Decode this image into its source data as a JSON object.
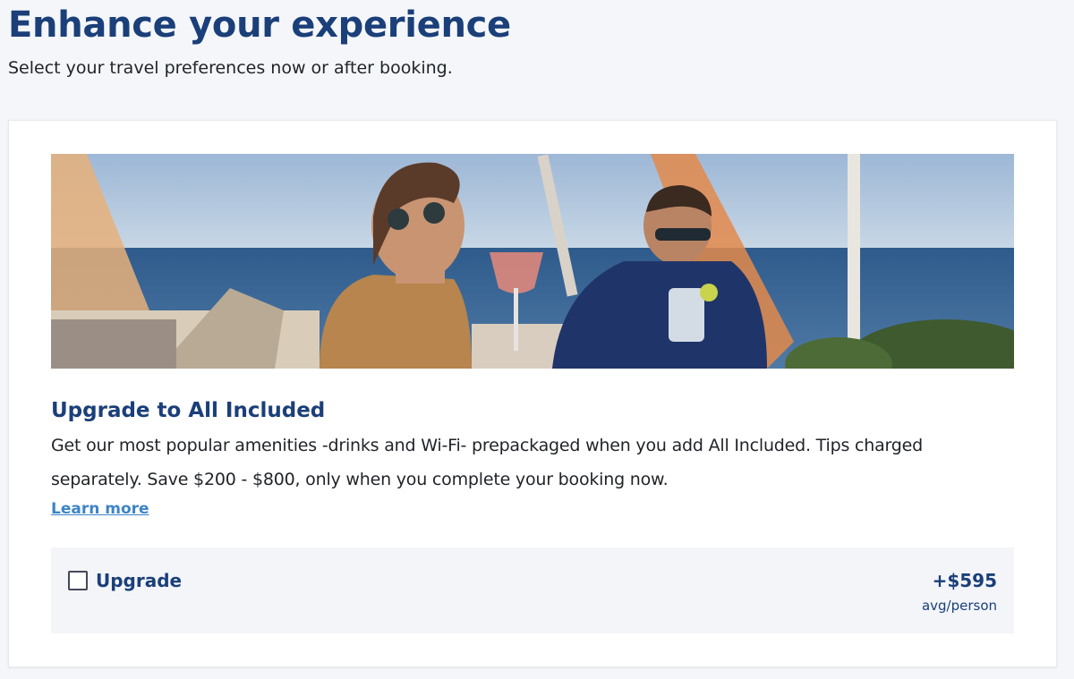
{
  "header": {
    "title": "Enhance your experience",
    "subtitle": "Select your travel preferences now or after booking."
  },
  "offer": {
    "image_alt": "Couple enjoying drinks on a cruise deck",
    "title": "Upgrade to All Included",
    "description": "Get our most popular amenities -drinks and Wi-Fi- prepackaged when you add All Included. Tips charged separately. Save $200 - $800, only when you complete your booking now.",
    "learn_more": "Learn more",
    "option": {
      "label": "Upgrade",
      "checked": false,
      "price": "+$595",
      "price_unit": "avg/person"
    }
  },
  "colors": {
    "brand_navy": "#1b3f79",
    "link_blue": "#3d84c6",
    "page_bg": "#f4f6f9",
    "option_bg": "#f3f5f8"
  }
}
